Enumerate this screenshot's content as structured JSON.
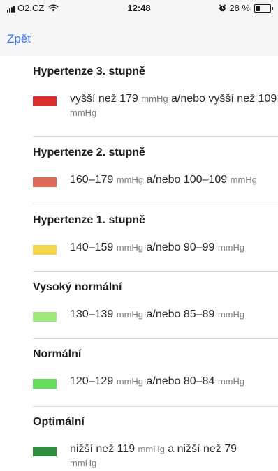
{
  "status_bar": {
    "carrier": "O2.CZ",
    "time": "12:48",
    "battery_percent": "28 %",
    "battery_level": 0.28,
    "icons": [
      "signal-icon",
      "wifi-icon",
      "alarm-icon",
      "battery-icon"
    ]
  },
  "nav": {
    "back_label": "Zpět",
    "accent_color": "#3478f6"
  },
  "categories": [
    {
      "title": "Hypertenze 3. stupně",
      "color": "#d6322b",
      "range": {
        "part1": "vyšší než 179",
        "unit1": "mmHg",
        "conj": "a/nebo vyšší než",
        "part2": "109",
        "unit2": "mmHg"
      }
    },
    {
      "title": "Hypertenze 2. stupně",
      "color": "#dc6a57",
      "range": {
        "part1": "160–179",
        "unit1": "mmHg",
        "conj": "a/nebo",
        "part2": "100–109",
        "unit2": "mmHg"
      }
    },
    {
      "title": "Hypertenze 1. stupně",
      "color": "#f3d74a",
      "range": {
        "part1": "140–159",
        "unit1": "mmHg",
        "conj": "a/nebo",
        "part2": "90–99",
        "unit2": "mmHg"
      }
    },
    {
      "title": "Vysoký normální",
      "color": "#9ee97d",
      "range": {
        "part1": "130–139",
        "unit1": "mmHg",
        "conj": "a/nebo",
        "part2": "85–89",
        "unit2": "mmHg"
      }
    },
    {
      "title": "Normální",
      "color": "#62dc5a",
      "range": {
        "part1": "120–129",
        "unit1": "mmHg",
        "conj": "a/nebo",
        "part2": "80–84",
        "unit2": "mmHg"
      }
    },
    {
      "title": "Optimální",
      "color": "#2e8f3c",
      "range": {
        "part1": "nižší než 119",
        "unit1": "mmHg",
        "conj": "a nižší než",
        "part2": "79",
        "unit2": "mmHg"
      }
    }
  ]
}
